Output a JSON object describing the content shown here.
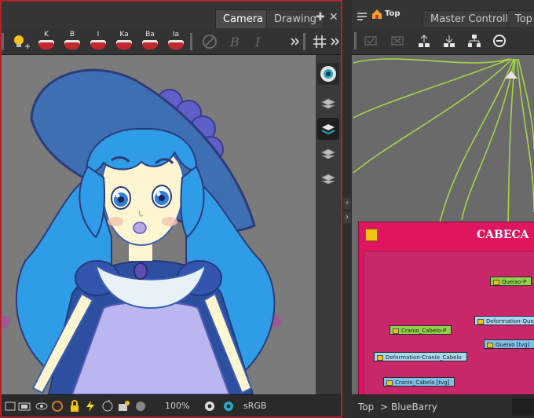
{
  "camera_panel": {
    "tabs": [
      {
        "label": "Camera",
        "active": true
      },
      {
        "label": "Drawing",
        "active": false
      }
    ],
    "toolbar": {
      "mouth_shapes": [
        "K",
        "B",
        "I",
        "Ka",
        "Ba",
        "Ia"
      ]
    },
    "statusbar": {
      "zoom": "100%",
      "color_space": "sRGB"
    }
  },
  "node_panel": {
    "tab_top_label": "Top",
    "tabs": [
      {
        "label": "Master Controller",
        "active": false
      },
      {
        "label": "Top",
        "active": false
      }
    ],
    "backdrop_title": "CABECA",
    "nodes": [
      {
        "label": "Queixo-P",
        "color": "green"
      },
      {
        "label": "Deformation-Queixo",
        "color": "blue"
      },
      {
        "label": "Queixo [tvg]",
        "color": "blue2"
      },
      {
        "label": "Cranio_Cabelo-P",
        "color": "green"
      },
      {
        "label": "Deformation-Cranio_Cabelo",
        "color": "blue"
      },
      {
        "label": "Cranio_Cabelo [tvg]",
        "color": "blue2"
      }
    ],
    "breadcrumb": [
      "Top",
      ">",
      "BlueBarry"
    ]
  },
  "colors": {
    "panel_focus_border": "#b0232a",
    "backdrop": "#e0155f",
    "peg_node": "#8fd24b",
    "deform_node": "#a9d7f1",
    "cable": "#a6d44a"
  }
}
